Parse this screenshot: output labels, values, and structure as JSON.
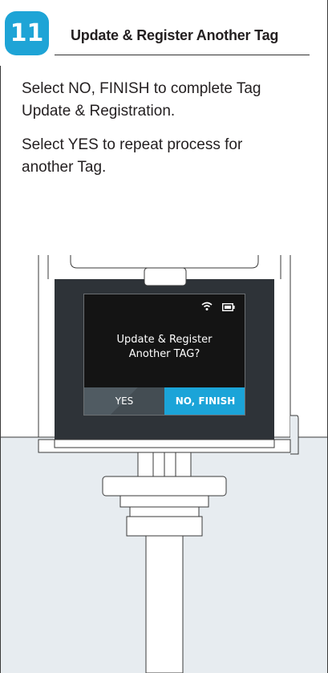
{
  "step": {
    "number": "11",
    "title": "Update & Register Another Tag"
  },
  "instructions": [
    "Select NO, FINISH to complete Tag Update & Registration.",
    "Select YES to repeat process for another Tag."
  ],
  "device": {
    "status_icons": [
      "wifi-icon",
      "battery-icon"
    ],
    "prompt_line1": "Update & Register",
    "prompt_line2": "Another TAG?",
    "yes_label": "YES",
    "no_label": "NO, FINISH"
  },
  "colors": {
    "accent": "#1ea4d6",
    "panel_bg": "#e7ecf0",
    "device_body": "#2e3338",
    "screen_bg": "#141414",
    "yes_button": "#505b62",
    "no_button": "#1ba4d8"
  }
}
